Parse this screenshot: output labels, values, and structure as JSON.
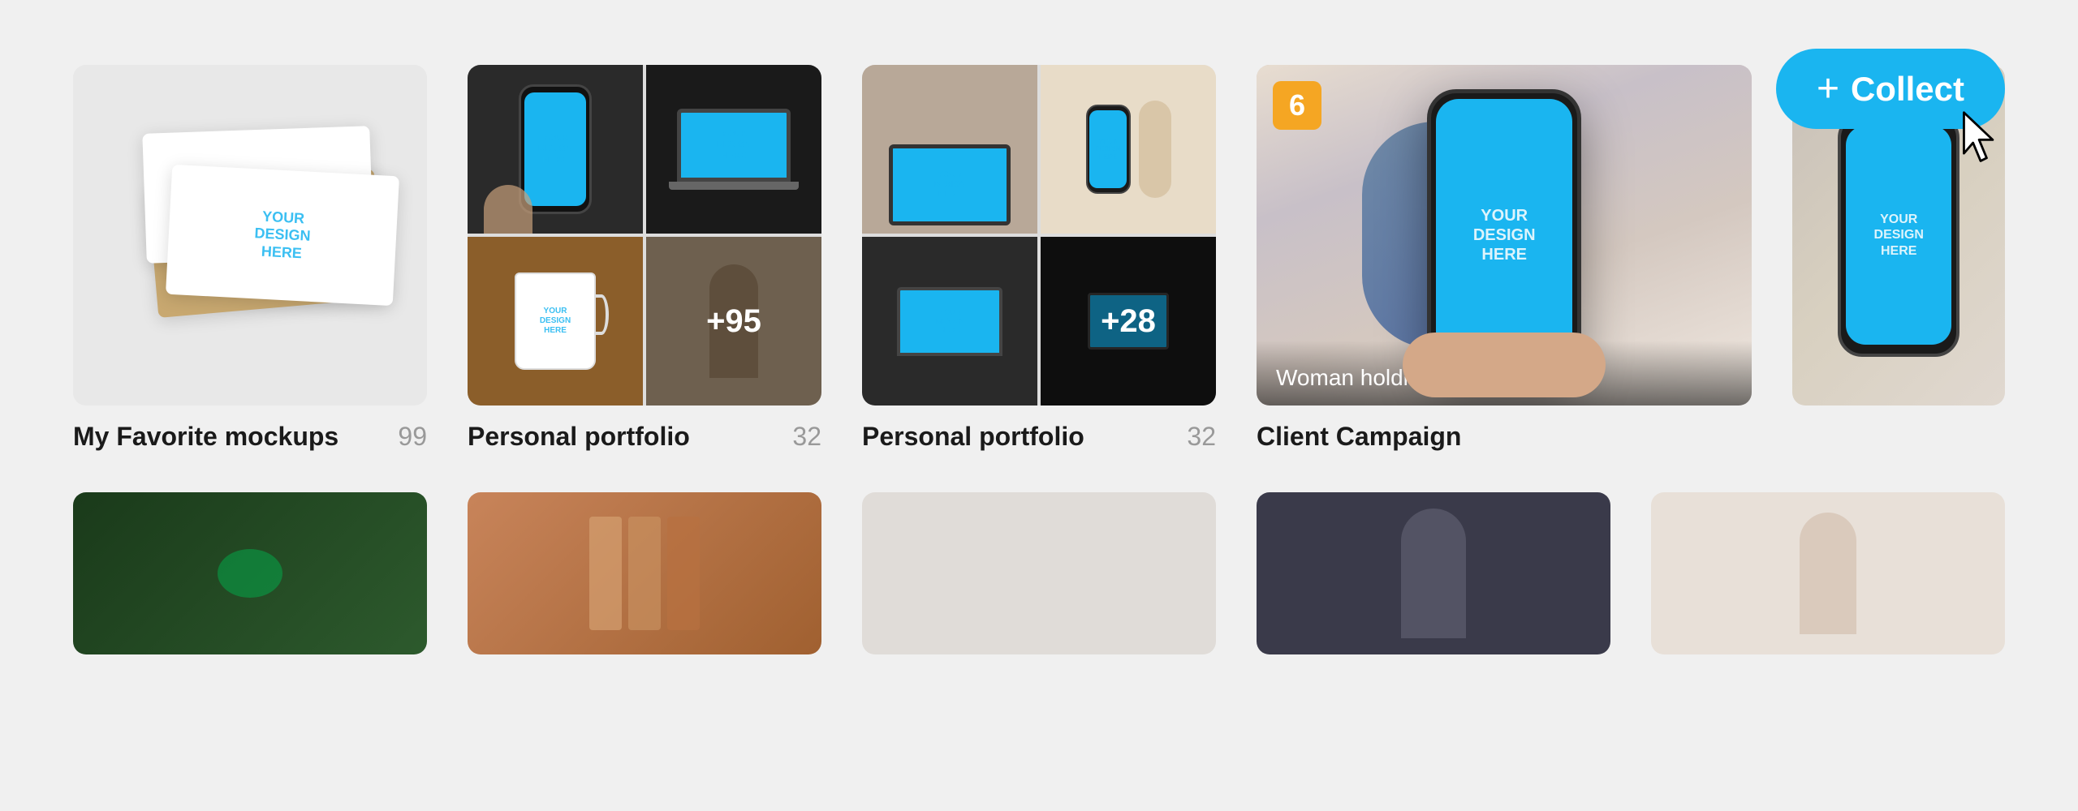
{
  "collect_button": {
    "label": "Collect",
    "plus": "+"
  },
  "collections": [
    {
      "id": "my-favorite-mockups",
      "name": "My Favorite mockups",
      "count": "99",
      "images": [
        {
          "type": "biz-cards",
          "bg": "light-gray"
        },
        {
          "type": "phone-hand",
          "bg": "dark"
        },
        {
          "type": "mug",
          "bg": "wood"
        },
        {
          "type": "woman",
          "bg": "cream",
          "overlay": "+95"
        }
      ]
    },
    {
      "id": "personal-portfolio",
      "name": "Personal portfolio",
      "count": "32",
      "images": [
        {
          "type": "phone-desk",
          "bg": "dark-desk"
        },
        {
          "type": "laptop",
          "bg": "dark"
        },
        {
          "type": "phone-bottle",
          "bg": "beige"
        },
        {
          "type": "laptop2",
          "bg": "dark",
          "overlay": "+28"
        }
      ]
    },
    {
      "id": "client-campaign",
      "name": "Client Campaign",
      "count": "",
      "badge": "6",
      "images": [
        {
          "type": "monitor",
          "bg": "teal"
        },
        {
          "type": "phone-hold",
          "bg": "hand-bg",
          "label": "Woman holding blue iPhone 12"
        }
      ]
    }
  ],
  "bottom_collections": [
    {
      "id": "bc1",
      "bg": "green-dark"
    },
    {
      "id": "bc2",
      "bg": "wood2"
    },
    {
      "id": "bc3",
      "bg": "neutral"
    },
    {
      "id": "bc4",
      "bg": "portrait"
    },
    {
      "id": "bc5",
      "bg": "portrait2"
    }
  ],
  "mockup_text": {
    "your_design_here": "YOUR\nDESIGN\nHERE"
  }
}
